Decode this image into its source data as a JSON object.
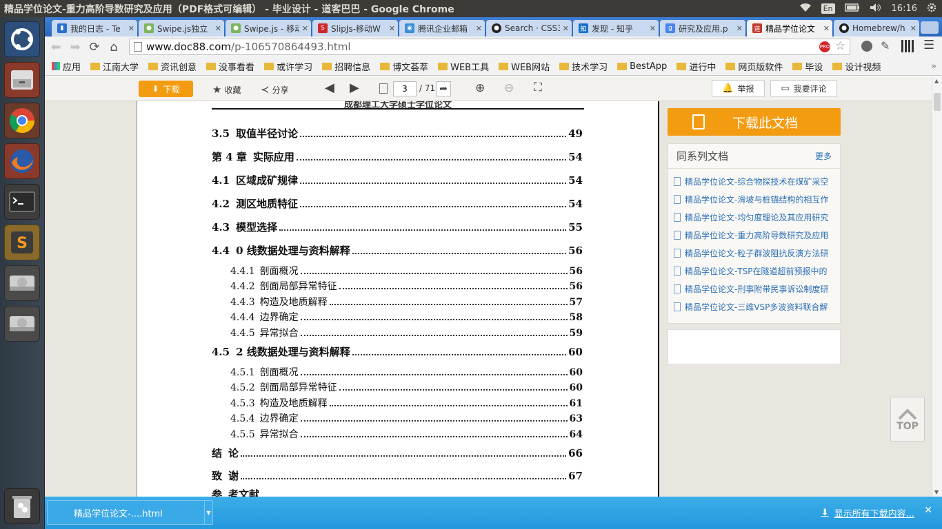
{
  "os": {
    "window_title": "精品学位论文-重力高阶导数研究及应用（PDF格式可编辑） - 毕业设计 - 道客巴巴 - Google Chrome",
    "keyboard_layout": "En",
    "clock": "16:16"
  },
  "tabs": [
    {
      "label": "我的日志 - Te",
      "favicon": "blue-bookmark-icon",
      "color": "#2a6fd0"
    },
    {
      "label": "Swipe.js独立",
      "favicon": "swipe-icon",
      "color": "#7cb65a"
    },
    {
      "label": "Swipe.js - 移动",
      "favicon": "swipe-icon",
      "color": "#7cb65a"
    },
    {
      "label": "SlipJs-移动W",
      "favicon": "slip-icon",
      "color": "#d0262b"
    },
    {
      "label": "腾讯企业邮箱",
      "favicon": "tencent-icon",
      "color": "#3b8fd9"
    },
    {
      "label": "Search · CSS3",
      "favicon": "github-icon",
      "color": "#222222"
    },
    {
      "label": "发现 - 知乎",
      "favicon": "zhihu-icon",
      "color": "#1a6fc7"
    },
    {
      "label": "研究及应用.p",
      "favicon": "google-icon",
      "color": "#4a85ee"
    },
    {
      "label": "精品学位论文",
      "favicon": "doc88-icon",
      "color": "#c0392b",
      "active": true
    },
    {
      "label": "Homebrew/h",
      "favicon": "github-icon",
      "color": "#222222"
    }
  ],
  "omnibox": {
    "host": "www.doc88.com",
    "path": "/p-106570864493.html"
  },
  "bookmarks": {
    "apps_label": "应用",
    "items": [
      "江南大学",
      "资讯创意",
      "没事看看",
      "或许学习",
      "招聘信息",
      "博文荟萃",
      "WEB工具",
      "WEB网站",
      "技术学习",
      "BestApp",
      "进行中",
      "网页版软件",
      "毕设",
      "设计视频"
    ]
  },
  "viewer_toolbar": {
    "download": "下载",
    "favorite": "收藏",
    "share": "分享",
    "page_current": "3",
    "page_total": "/ 71",
    "report": "举报",
    "comment": "我要评论"
  },
  "document": {
    "header_text": "成都理工大学硕士学位论文",
    "toc": [
      {
        "num": "3.5",
        "title": "取值半径讨论",
        "page": "49",
        "level": 1
      },
      {
        "num": "第 4 章",
        "title": "实际应用",
        "page": "54",
        "level": 1
      },
      {
        "num": "4.1",
        "title": "区域成矿规律",
        "page": "54",
        "level": 1
      },
      {
        "num": "4.2",
        "title": "测区地质特征",
        "page": "54",
        "level": 1
      },
      {
        "num": "4.3",
        "title": "模型选择",
        "page": "55",
        "level": 1
      },
      {
        "num": "4.4",
        "title": "0 线数据处理与资料解释",
        "page": "56",
        "level": 1
      },
      {
        "num": "4.4.1",
        "title": "剖面概况",
        "page": "56",
        "level": 2
      },
      {
        "num": "4.4.2",
        "title": "剖面局部异常特征",
        "page": "56",
        "level": 2
      },
      {
        "num": "4.4.3",
        "title": "构造及地质解释",
        "page": "57",
        "level": 2
      },
      {
        "num": "4.4.4",
        "title": "边界确定",
        "page": "58",
        "level": 2
      },
      {
        "num": "4.4.5",
        "title": "异常拟合",
        "page": "59",
        "level": 2
      },
      {
        "num": "4.5",
        "title": "2 线数据处理与资料解释",
        "page": "60",
        "level": 1
      },
      {
        "num": "4.5.1",
        "title": "剖面概况",
        "page": "60",
        "level": 2
      },
      {
        "num": "4.5.2",
        "title": "剖面局部异常特征",
        "page": "60",
        "level": 2
      },
      {
        "num": "4.5.3",
        "title": "构造及地质解释",
        "page": "61",
        "level": 2
      },
      {
        "num": "4.5.4",
        "title": "边界确定",
        "page": "63",
        "level": 2
      },
      {
        "num": "4.5.5",
        "title": "异常拟合",
        "page": "64",
        "level": 2
      },
      {
        "num": "结",
        "title": "论",
        "page": "66",
        "level": 1
      },
      {
        "num": "致",
        "title": "谢",
        "page": "67",
        "level": 1
      },
      {
        "num": "参",
        "title": "考文献",
        "page": "",
        "level": 1
      }
    ]
  },
  "sidebar": {
    "download_doc": "下载此文档",
    "series_title": "同系列文档",
    "more": "更多",
    "series": [
      "精品学位论文-综合物探技术在煤矿采空",
      "精品学位论文-滑坡与桩锚结构的相互作",
      "精品学位论文-均匀度理论及其应用研究",
      "精品学位论文-重力高阶导数研究及应用",
      "精品学位论文-粒子群波阻抗反演方法研",
      "精品学位论文-TSP在隧道超前预报中的",
      "精品学位论文-刑事附带民事诉讼制度研",
      "精品学位论文-三维VSP多波资料联合解"
    ],
    "top_label": "TOP"
  },
  "download_shelf": {
    "item": "精品学位论文-....html",
    "show_all": "显示所有下载内容..."
  },
  "colors": {
    "accent_orange": "#f39c12",
    "link_blue": "#2a6fb8",
    "tabstrip_blue": "#2c6ec6",
    "shelf_blue": "#2fa4e7"
  }
}
